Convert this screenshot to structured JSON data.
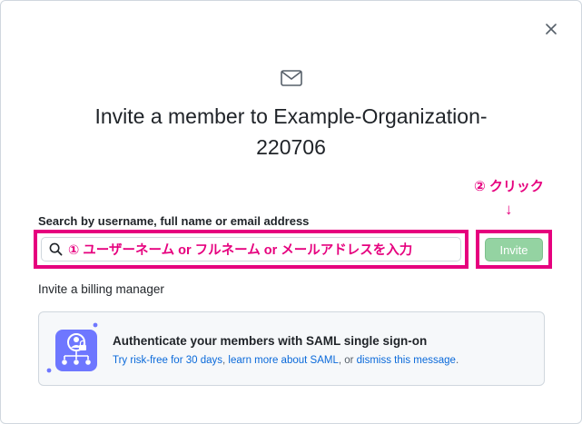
{
  "dialog": {
    "title_line1": "Invite a member to Example-Organization-",
    "title_line2": "220706",
    "close_icon": "close-icon",
    "header_icon": "mail-icon"
  },
  "annotations": {
    "click_label": "② クリック",
    "arrow": "↓",
    "search_label": "① ユーザーネーム or フルネーム or メールアドレスを入力",
    "color": "#e6007e"
  },
  "search": {
    "label": "Search by username, full name or email address",
    "value": "",
    "icon": "search-icon"
  },
  "invite_button": {
    "label": "Invite",
    "color": "#94d3a2"
  },
  "billing": {
    "link_text": "Invite a billing manager"
  },
  "saml": {
    "heading": "Authenticate your members with SAML single sign-on",
    "desc_link1": "Try risk-free for 30 days",
    "desc_sep1": ", ",
    "desc_link2": "learn more about SAML",
    "desc_sep2": ", or ",
    "desc_link3": "dismiss this message",
    "desc_end": "."
  }
}
